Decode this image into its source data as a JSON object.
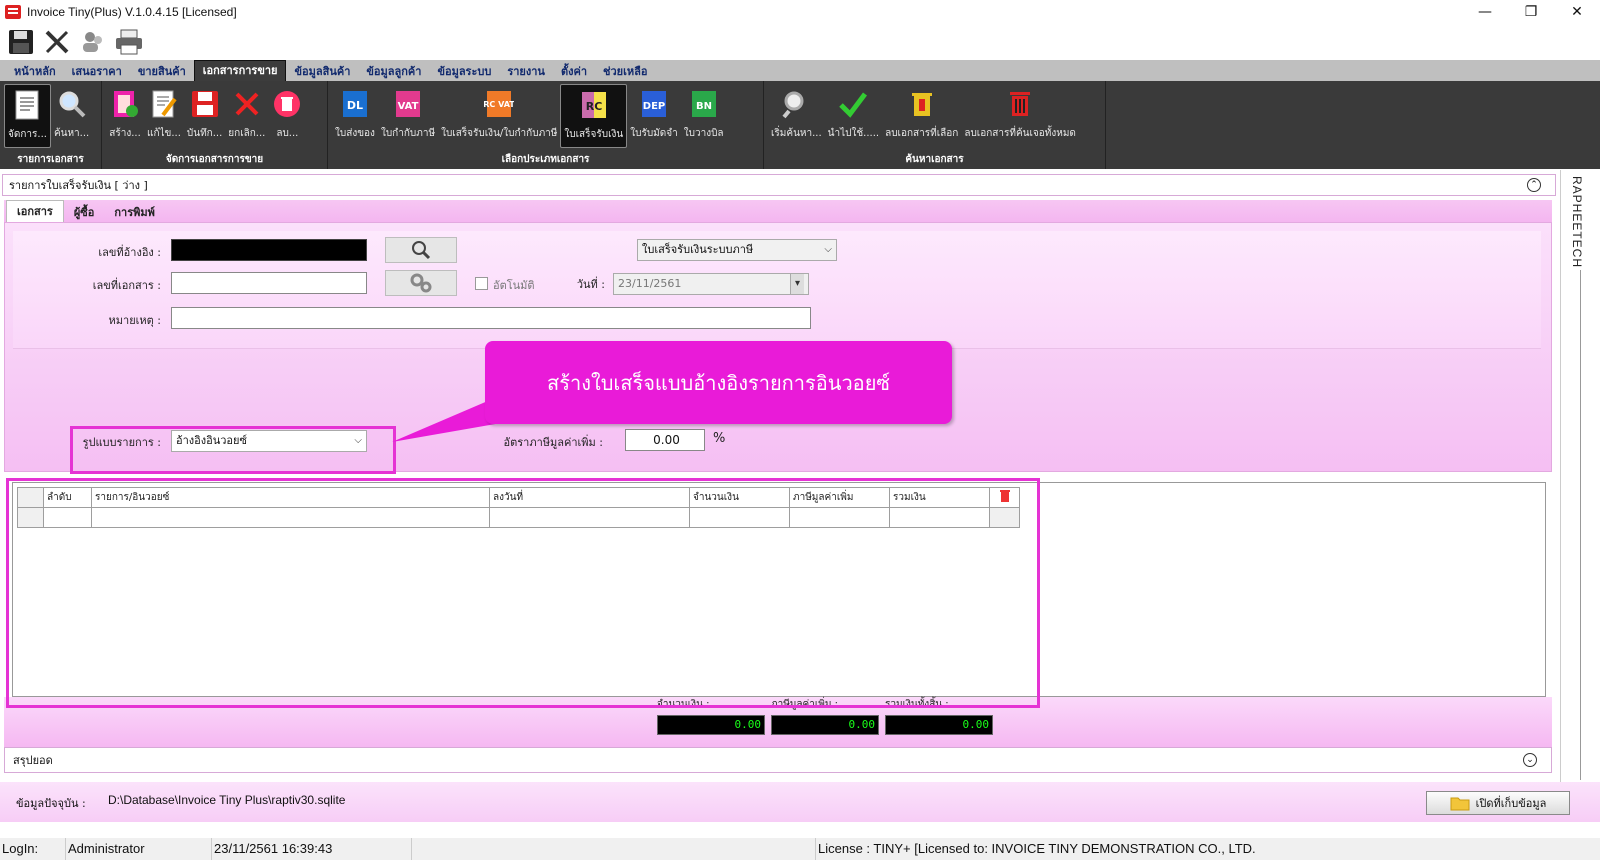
{
  "window": {
    "title": "Invoice Tiny(Plus)  V.1.0.4.15 [Licensed]",
    "controls": {
      "minimize": "—",
      "restore": "❐",
      "close": "✕"
    }
  },
  "quick_access": [
    {
      "icon": "save-icon"
    },
    {
      "icon": "tools-icon"
    },
    {
      "icon": "users-icon"
    },
    {
      "icon": "printer-icon"
    }
  ],
  "menu_tabs": [
    {
      "label": "หน้าหลัก"
    },
    {
      "label": "เสนอราคา"
    },
    {
      "label": "ขายสินค้า"
    },
    {
      "label": "เอกสารการขาย",
      "active": true
    },
    {
      "label": "ข้อมูลสินค้า"
    },
    {
      "label": "ข้อมูลลูกค้า"
    },
    {
      "label": "ข้อมูลระบบ"
    },
    {
      "label": "รายงาน"
    },
    {
      "label": "ตั้งค่า"
    },
    {
      "label": "ช่วยเหลือ"
    }
  ],
  "ribbon": {
    "group1": {
      "label": "รายการเอกสาร",
      "buttons": [
        "จัดการ...",
        "ค้นหา..."
      ]
    },
    "group2": {
      "label": "จัดการเอกสารการขาย",
      "buttons": [
        "สร้าง...",
        "แก้ไข...",
        "บันทึก...",
        "ยกเลิก...",
        "ลบ..."
      ]
    },
    "group3": {
      "label": "เลือกประเภทเอกสาร",
      "buttons": [
        "ใบส่งของ",
        "ใบกำกับภาษี",
        "ใบเสร็จรับเงิน/ใบกำกับภาษี",
        "ใบเสร็จรับเงิน",
        "ใบรับมัดจำ",
        "ใบวางบิล"
      ],
      "icon_texts": [
        "DL",
        "VAT",
        "RC VAT",
        "RC",
        "DEP",
        "BN"
      ]
    },
    "group4": {
      "label": "ค้นหาเอกสาร",
      "buttons": [
        "เริ่มค้นหา...",
        "นำไปใช้.....",
        "ลบเอกสารที่เลือก",
        "ลบเอกสารที่ค้นเจอทั้งหมด"
      ]
    },
    "colors": {
      "background": "#3a3a3a",
      "accent_pink": "#e91bd8"
    }
  },
  "panel": {
    "title": "รายการใบเสร็จรับเงิน [ ว่าง ]",
    "subtabs": [
      {
        "label": "เอกสาร",
        "active": true
      },
      {
        "label": "ผู้ซื้อ"
      },
      {
        "label": "การพิมพ์"
      }
    ]
  },
  "form": {
    "ref_no_label": "เลขที่อ้างอิง :",
    "ref_no_value": "",
    "doc_no_label": "เลขที่เอกสาร :",
    "doc_no_value": "",
    "note_label": "หมายเหตุ :",
    "note_value": "",
    "auto_label": "อัตโนมัติ",
    "doc_type_value": "ใบเสร็จรับเงินระบบภาษี",
    "date_label": "วันที่ :",
    "date_value": "23/11/2561",
    "list_format_label": "รูปแบบรายการ :",
    "list_format_value": "อ้างอิงอินวอยซ์",
    "vat_rate_label": "อัตราภาษีมูลค่าเพิ่ม :",
    "vat_rate_value": "0.00",
    "vat_rate_unit": "%"
  },
  "callout": {
    "text": "สร้างใบเสร็จแบบอ้างอิงรายการอินวอยซ์"
  },
  "grid": {
    "columns": [
      "ลำดับ",
      "รายการ/อินวอยซ์",
      "ลงวันที่",
      "จำนวนเงิน",
      "ภาษีมูลค่าเพิ่ม",
      "รวมเงิน"
    ],
    "rows": [
      {
        "seq": "",
        "item": "",
        "date": "",
        "amount": "",
        "vat": "",
        "total": ""
      }
    ]
  },
  "totals": {
    "amount_label": "จำนวนเงิน :",
    "amount_value": "0.00",
    "vat_label": "ภาษีมูลค่าเพิ่ม :",
    "vat_value": "0.00",
    "grand_label": "รวมเงินทั้งสิ้น :",
    "grand_value": "0.00"
  },
  "summary": {
    "label": "สรุปยอด"
  },
  "sidebar": {
    "text": "RAPHEETECH"
  },
  "footer": {
    "current_label": "ข้อมูลปัจจุบัน :",
    "path": "D:\\Database\\Invoice Tiny Plus\\raptiv30.sqlite",
    "open_button": "เปิดที่เก็บข้อมูล"
  },
  "status": {
    "login_label": "LogIn:",
    "user": "Administrator",
    "datetime": "23/11/2561 16:39:43",
    "license": "License : TINY+ [Licensed to: INVOICE TINY DEMONSTRATION CO., LTD."
  }
}
